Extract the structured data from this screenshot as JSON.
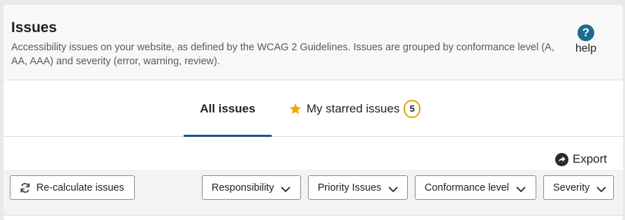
{
  "header": {
    "title": "Issues",
    "description": "Accessibility issues on your website, as defined by the WCAG 2 Guidelines. Issues are grouped by conformance level (A, AA, AAA) and severity (error, warning, review).",
    "help_label": "help",
    "help_icon": "question-circle-icon"
  },
  "tabs": {
    "all_label": "All issues",
    "starred_label": "My starred issues",
    "starred_count": "5",
    "active": "All issues"
  },
  "actions": {
    "export_label": "Export",
    "recalculate_label": "Re-calculate issues"
  },
  "filters": {
    "responsibility": "Responsibility",
    "priority": "Priority Issues",
    "conformance": "Conformance level",
    "severity": "Severity"
  },
  "colors": {
    "accent": "#1d4e96",
    "badge_border": "#e8a200",
    "star": "#f2a900",
    "help_icon_bg": "#1b6d8c"
  }
}
